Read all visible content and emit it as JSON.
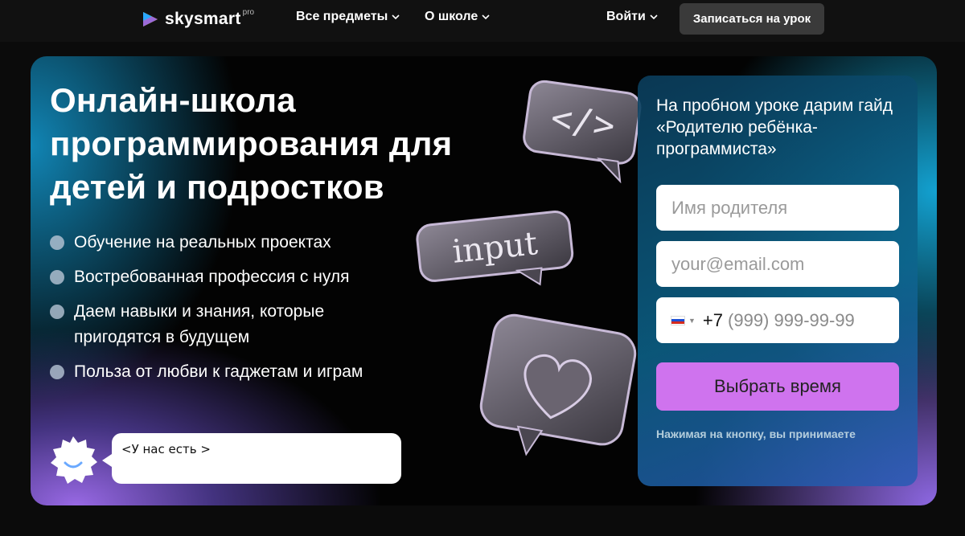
{
  "header": {
    "logo": {
      "wordmark": "skysmart",
      "badge": "pro"
    },
    "nav": [
      {
        "label": "Все предметы"
      },
      {
        "label": "О школе"
      }
    ],
    "login_label": "Войти",
    "cta_label": "Записаться на урок"
  },
  "hero": {
    "title": "Онлайн-школа программирования для детей и подростков",
    "features": [
      "Обучение на реальных проектах",
      "Востребованная профессия с нуля",
      "Даем навыки и знания, которые пригодятся в будущем",
      "Польза от любви к гаджетам и играм"
    ],
    "chat_bubble": "<У нас есть >",
    "decor": {
      "code_tag": "</>",
      "input_word": "input"
    }
  },
  "form": {
    "title": "На пробном уроке дарим гайд «Родителю ребёнка-программиста»",
    "name_placeholder": "Имя родителя",
    "email_placeholder": "your@email.com",
    "phone_code": "+7",
    "phone_placeholder": "(999) 999-99-99",
    "submit_label": "Выбрать время",
    "note": "Нажимая на кнопку, вы принимаете"
  },
  "colors": {
    "header_bg": "#111111",
    "cta_bg": "#3a3a3a",
    "submit_bg": "#cf73ee",
    "accent_blue": "#1496cc",
    "accent_purple": "#9a6ef0"
  },
  "icons": [
    "logo-play-icon",
    "chevron-down-icon",
    "russia-flag-icon",
    "smiley-sun-icon",
    "heart-icon"
  ]
}
